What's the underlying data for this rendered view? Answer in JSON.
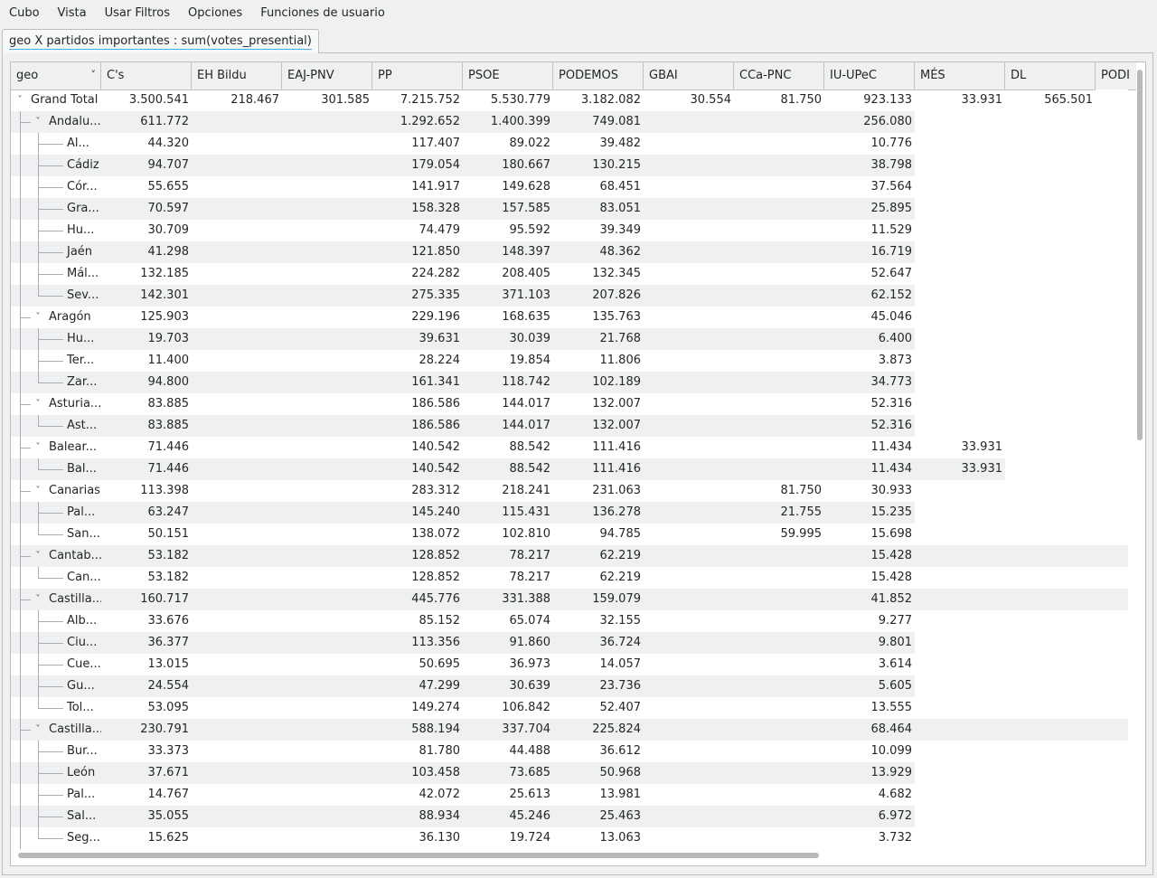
{
  "menu": [
    "Cubo",
    "Vista",
    "Usar Filtros",
    "Opciones",
    "Funciones de usuario"
  ],
  "tab_label": "geo X partidos importantes : sum(votes_presential)",
  "columns": [
    "geo",
    "C's",
    "EH Bildu",
    "EAJ-PNV",
    "PP",
    "PSOE",
    "PODEMOS",
    "GBAI",
    "CCa-PNC",
    "IU-UPeC",
    "MÉS",
    "DL",
    "PODI"
  ],
  "rows": [
    {
      "label": "Grand Total",
      "level": 0,
      "vals": [
        "3.500.541",
        "218.467",
        "301.585",
        "7.215.752",
        "5.530.779",
        "3.182.082",
        "30.554",
        "81.750",
        "923.133",
        "33.931",
        "565.501",
        ""
      ],
      "n": 11
    },
    {
      "label": "Andalu...",
      "level": 1,
      "vals": [
        "611.772",
        "",
        "",
        "1.292.652",
        "1.400.399",
        "749.081",
        "",
        "",
        "256.080",
        "",
        "",
        ""
      ],
      "n": 9
    },
    {
      "label": "Al...",
      "level": 2,
      "vals": [
        "44.320",
        "",
        "",
        "117.407",
        "89.022",
        "39.482",
        "",
        "",
        "10.776",
        "",
        "",
        ""
      ],
      "n": 9
    },
    {
      "label": "Cádiz",
      "level": 2,
      "vals": [
        "94.707",
        "",
        "",
        "179.054",
        "180.667",
        "130.215",
        "",
        "",
        "38.798",
        "",
        "",
        ""
      ],
      "n": 9
    },
    {
      "label": "Cór...",
      "level": 2,
      "vals": [
        "55.655",
        "",
        "",
        "141.917",
        "149.628",
        "68.451",
        "",
        "",
        "37.564",
        "",
        "",
        ""
      ],
      "n": 9
    },
    {
      "label": "Gra...",
      "level": 2,
      "vals": [
        "70.597",
        "",
        "",
        "158.328",
        "157.585",
        "83.051",
        "",
        "",
        "25.895",
        "",
        "",
        ""
      ],
      "n": 9
    },
    {
      "label": "Hu...",
      "level": 2,
      "vals": [
        "30.709",
        "",
        "",
        "74.479",
        "95.592",
        "39.349",
        "",
        "",
        "11.529",
        "",
        "",
        ""
      ],
      "n": 9
    },
    {
      "label": "Jaén",
      "level": 2,
      "vals": [
        "41.298",
        "",
        "",
        "121.850",
        "148.397",
        "48.362",
        "",
        "",
        "16.719",
        "",
        "",
        ""
      ],
      "n": 9
    },
    {
      "label": "Mál...",
      "level": 2,
      "vals": [
        "132.185",
        "",
        "",
        "224.282",
        "208.405",
        "132.345",
        "",
        "",
        "52.647",
        "",
        "",
        ""
      ],
      "n": 9
    },
    {
      "label": "Sev...",
      "level": 2,
      "vals": [
        "142.301",
        "",
        "",
        "275.335",
        "371.103",
        "207.826",
        "",
        "",
        "62.152",
        "",
        "",
        ""
      ],
      "n": 9
    },
    {
      "label": "Aragón",
      "level": 1,
      "vals": [
        "125.903",
        "",
        "",
        "229.196",
        "168.635",
        "135.763",
        "",
        "",
        "45.046",
        "",
        "",
        ""
      ],
      "n": 9
    },
    {
      "label": "Hu...",
      "level": 2,
      "vals": [
        "19.703",
        "",
        "",
        "39.631",
        "30.039",
        "21.768",
        "",
        "",
        "6.400",
        "",
        "",
        ""
      ],
      "n": 9
    },
    {
      "label": "Ter...",
      "level": 2,
      "vals": [
        "11.400",
        "",
        "",
        "28.224",
        "19.854",
        "11.806",
        "",
        "",
        "3.873",
        "",
        "",
        ""
      ],
      "n": 9
    },
    {
      "label": "Zar...",
      "level": 2,
      "vals": [
        "94.800",
        "",
        "",
        "161.341",
        "118.742",
        "102.189",
        "",
        "",
        "34.773",
        "",
        "",
        ""
      ],
      "n": 9
    },
    {
      "label": "Asturia...",
      "level": 1,
      "vals": [
        "83.885",
        "",
        "",
        "186.586",
        "144.017",
        "132.007",
        "",
        "",
        "52.316",
        "",
        "",
        ""
      ],
      "n": 9
    },
    {
      "label": "Ast...",
      "level": 2,
      "vals": [
        "83.885",
        "",
        "",
        "186.586",
        "144.017",
        "132.007",
        "",
        "",
        "52.316",
        "",
        "",
        ""
      ],
      "n": 9
    },
    {
      "label": "Balear...",
      "level": 1,
      "vals": [
        "71.446",
        "",
        "",
        "140.542",
        "88.542",
        "111.416",
        "",
        "",
        "11.434",
        "33.931",
        "",
        ""
      ],
      "n": 10
    },
    {
      "label": "Bal...",
      "level": 2,
      "vals": [
        "71.446",
        "",
        "",
        "140.542",
        "88.542",
        "111.416",
        "",
        "",
        "11.434",
        "33.931",
        "",
        ""
      ],
      "n": 10
    },
    {
      "label": "Canarias",
      "level": 1,
      "vals": [
        "113.398",
        "",
        "",
        "283.312",
        "218.241",
        "231.063",
        "",
        "81.750",
        "30.933",
        "",
        "",
        ""
      ],
      "n": 9
    },
    {
      "label": "Pal...",
      "level": 2,
      "vals": [
        "63.247",
        "",
        "",
        "145.240",
        "115.431",
        "136.278",
        "",
        "21.755",
        "15.235",
        "",
        "",
        ""
      ],
      "n": 9
    },
    {
      "label": "San...",
      "level": 2,
      "vals": [
        "50.151",
        "",
        "",
        "138.072",
        "102.810",
        "94.785",
        "",
        "59.995",
        "15.698",
        "",
        "",
        ""
      ],
      "n": 9
    },
    {
      "label": "Cantab...",
      "level": 1,
      "vals": [
        "53.182",
        "",
        "",
        "128.852",
        "78.217",
        "62.219",
        "",
        "",
        "15.428",
        "",
        "",
        ""
      ],
      "n": 13
    },
    {
      "label": "Can...",
      "level": 2,
      "vals": [
        "53.182",
        "",
        "",
        "128.852",
        "78.217",
        "62.219",
        "",
        "",
        "15.428",
        "",
        "",
        ""
      ],
      "n": 9
    },
    {
      "label": "Castilla...",
      "level": 1,
      "vals": [
        "160.717",
        "",
        "",
        "445.776",
        "331.388",
        "159.079",
        "",
        "",
        "41.852",
        "",
        "",
        ""
      ],
      "n": 13
    },
    {
      "label": "Alb...",
      "level": 2,
      "vals": [
        "33.676",
        "",
        "",
        "85.152",
        "65.074",
        "32.155",
        "",
        "",
        "9.277",
        "",
        "",
        ""
      ],
      "n": 9
    },
    {
      "label": "Ciu...",
      "level": 2,
      "vals": [
        "36.377",
        "",
        "",
        "113.356",
        "91.860",
        "36.724",
        "",
        "",
        "9.801",
        "",
        "",
        ""
      ],
      "n": 9
    },
    {
      "label": "Cue...",
      "level": 2,
      "vals": [
        "13.015",
        "",
        "",
        "50.695",
        "36.973",
        "14.057",
        "",
        "",
        "3.614",
        "",
        "",
        ""
      ],
      "n": 9
    },
    {
      "label": "Gu...",
      "level": 2,
      "vals": [
        "24.554",
        "",
        "",
        "47.299",
        "30.639",
        "23.736",
        "",
        "",
        "5.605",
        "",
        "",
        ""
      ],
      "n": 9
    },
    {
      "label": "Tol...",
      "level": 2,
      "vals": [
        "53.095",
        "",
        "",
        "149.274",
        "106.842",
        "52.407",
        "",
        "",
        "13.555",
        "",
        "",
        ""
      ],
      "n": 9
    },
    {
      "label": "Castilla...",
      "level": 1,
      "vals": [
        "230.791",
        "",
        "",
        "588.194",
        "337.704",
        "225.824",
        "",
        "",
        "68.464",
        "",
        "",
        ""
      ],
      "n": 13
    },
    {
      "label": "Bur...",
      "level": 2,
      "vals": [
        "33.373",
        "",
        "",
        "81.780",
        "44.488",
        "36.612",
        "",
        "",
        "10.099",
        "",
        "",
        ""
      ],
      "n": 9
    },
    {
      "label": "León",
      "level": 2,
      "vals": [
        "37.671",
        "",
        "",
        "103.458",
        "73.685",
        "50.968",
        "",
        "",
        "13.929",
        "",
        "",
        ""
      ],
      "n": 9
    },
    {
      "label": "Pal...",
      "level": 2,
      "vals": [
        "14.767",
        "",
        "",
        "42.072",
        "25.613",
        "13.981",
        "",
        "",
        "4.682",
        "",
        "",
        ""
      ],
      "n": 9
    },
    {
      "label": "Sal...",
      "level": 2,
      "vals": [
        "35.055",
        "",
        "",
        "88.934",
        "45.246",
        "25.463",
        "",
        "",
        "6.972",
        "",
        "",
        ""
      ],
      "n": 9
    },
    {
      "label": "Seg...",
      "level": 2,
      "vals": [
        "15.625",
        "",
        "",
        "36.130",
        "19.724",
        "13.063",
        "",
        "",
        "3.732",
        "",
        "",
        ""
      ],
      "n": 9
    }
  ]
}
